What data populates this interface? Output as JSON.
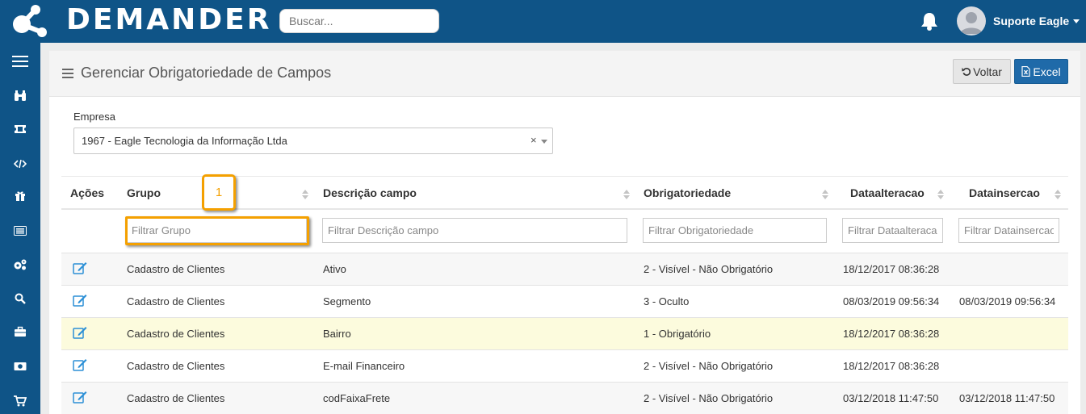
{
  "header": {
    "brand": "DEMANDER",
    "search_placeholder": "Buscar...",
    "user_name": "Suporte Eagle"
  },
  "sidebar": {
    "items": [
      {
        "icon": "hamburger-menu-icon"
      },
      {
        "icon": "binoculars-icon"
      },
      {
        "icon": "ticket-icon"
      },
      {
        "icon": "code-icon"
      },
      {
        "icon": "gift-icon"
      },
      {
        "icon": "list-card-icon"
      },
      {
        "icon": "cogs-icon"
      },
      {
        "icon": "search-icon"
      },
      {
        "icon": "briefcase-icon"
      },
      {
        "icon": "money-icon"
      },
      {
        "icon": "cart-icon"
      }
    ]
  },
  "page": {
    "title": "Gerenciar Obrigatoriedade de Campos",
    "voltar_label": "Voltar",
    "excel_label": "Excel"
  },
  "empresa": {
    "label": "Empresa",
    "value": "1967 - Eagle Tecnologia da Informação Ltda",
    "clear": "×"
  },
  "callout": {
    "number": "1",
    "color": "#f4a000"
  },
  "table": {
    "headers": [
      "Ações",
      "Grupo",
      "Descrição campo",
      "Obrigatoriedade",
      "Dataalteracao",
      "Datainsercao"
    ],
    "filters": [
      "Filtrar Grupo",
      "Filtrar Descrição campo",
      "Filtrar Obrigatoriedade",
      "Filtrar Dataalteracao",
      "Filtrar Datainsercao"
    ],
    "rows": [
      {
        "grupo": "Cadastro de Clientes",
        "descricao": "Ativo",
        "obrigatoriedade": "2 - Visível - Não Obrigatório",
        "dataalteracao": "18/12/2017 08:36:28",
        "datainsercao": ""
      },
      {
        "grupo": "Cadastro de Clientes",
        "descricao": "Segmento",
        "obrigatoriedade": "3 - Oculto",
        "dataalteracao": "08/03/2019 09:56:34",
        "datainsercao": "08/03/2019 09:56:34"
      },
      {
        "grupo": "Cadastro de Clientes",
        "descricao": "Bairro",
        "obrigatoriedade": "1 - Obrigatório",
        "dataalteracao": "18/12/2017 08:36:28",
        "datainsercao": ""
      },
      {
        "grupo": "Cadastro de Clientes",
        "descricao": "E-mail Financeiro",
        "obrigatoriedade": "2 - Visível - Não Obrigatório",
        "dataalteracao": "18/12/2017 08:36:28",
        "datainsercao": ""
      },
      {
        "grupo": "Cadastro de Clientes",
        "descricao": "codFaixaFrete",
        "obrigatoriedade": "2 - Visível - Não Obrigatório",
        "dataalteracao": "03/12/2018 11:47:50",
        "datainsercao": "03/12/2018 11:47:50"
      }
    ]
  },
  "colors": {
    "header_bg": "#0f5487",
    "accent_blue": "#1f6aa9",
    "highlight_orange": "#f4a000",
    "highlight_row": "#fcfbdd"
  }
}
